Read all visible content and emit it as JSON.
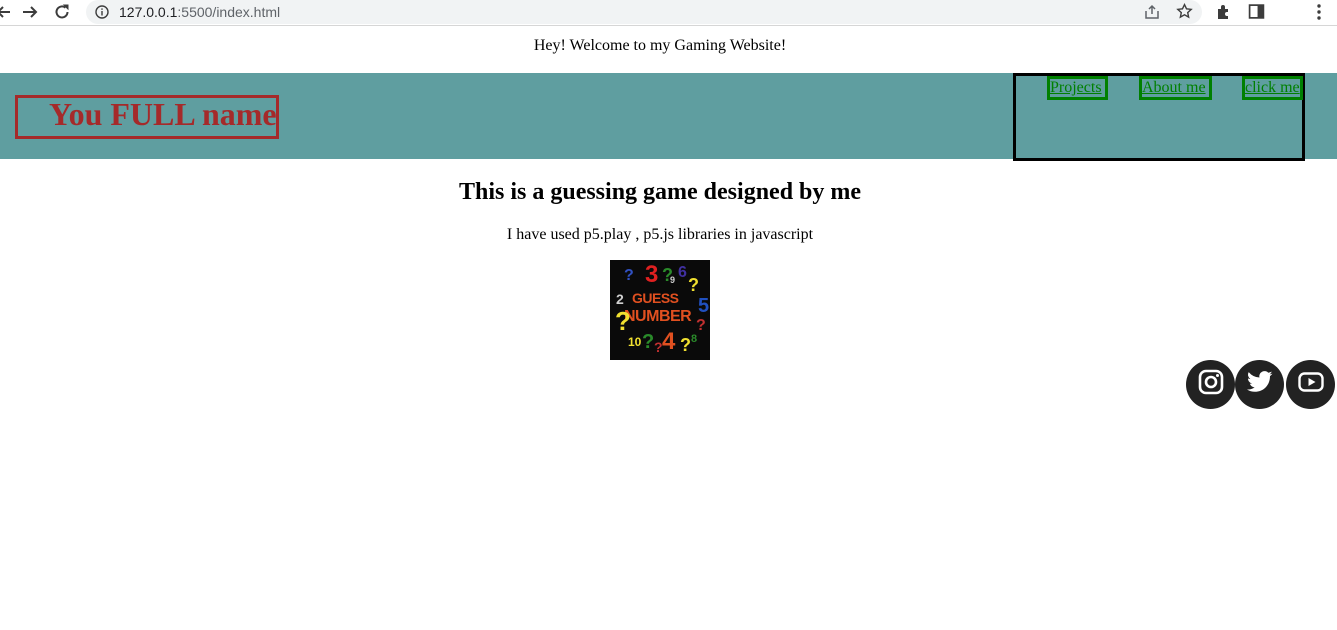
{
  "browser": {
    "url_host": "127.0.0.1",
    "url_rest": ":5500/index.html"
  },
  "page": {
    "welcome": "Hey! Welcome to my Gaming Website!",
    "logo": "You FULL name",
    "nav": {
      "projects": "Projects",
      "about": "About me",
      "click": "click me"
    },
    "heading": "This is a guessing game designed by me",
    "description": "I have used p5.play , p5.js libraries in javascript",
    "game_image": {
      "title_line1": "GUESS",
      "title_line2": "NUMBER",
      "decor": [
        "?",
        "3",
        "?",
        "9",
        "6",
        "?",
        "2",
        "5",
        "?",
        "?",
        "10",
        "?",
        "4",
        "?",
        "8",
        "?"
      ]
    },
    "social": [
      "instagram-icon",
      "twitter-icon",
      "youtube-icon"
    ]
  },
  "colors": {
    "header_bg": "#5f9ea0",
    "logo": "#a52a2a",
    "nav_link": "#008000",
    "social_bg": "#222222"
  }
}
